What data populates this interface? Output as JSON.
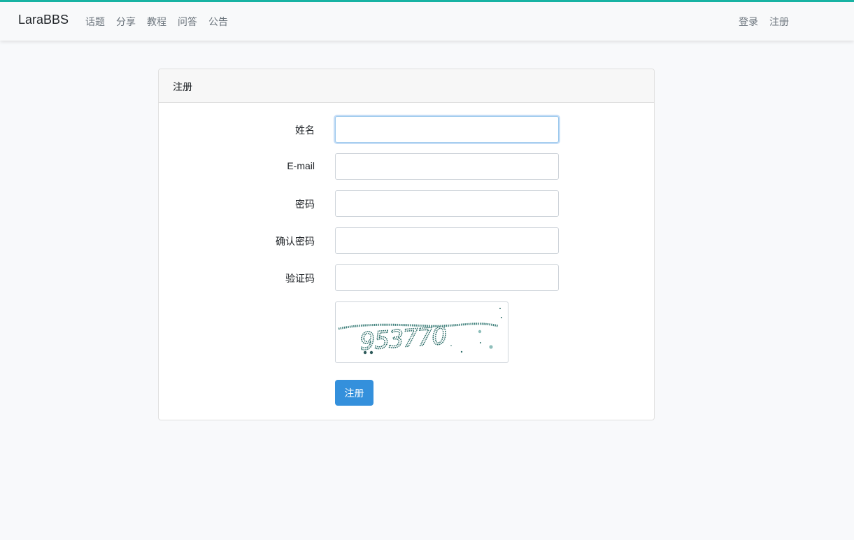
{
  "header": {
    "brand": "LaraBBS",
    "nav": [
      {
        "label": "话题"
      },
      {
        "label": "分享"
      },
      {
        "label": "教程"
      },
      {
        "label": "问答"
      },
      {
        "label": "公告"
      }
    ],
    "auth": {
      "login": "登录",
      "register": "注册"
    },
    "accent_color": "#17b3a3"
  },
  "card": {
    "title": "注册",
    "fields": [
      {
        "label": "姓名",
        "value": ""
      },
      {
        "label": "E-mail",
        "value": ""
      },
      {
        "label": "密码",
        "value": ""
      },
      {
        "label": "确认密码",
        "value": ""
      },
      {
        "label": "验证码",
        "value": ""
      }
    ],
    "captcha_text": "953770",
    "submit_label": "注册",
    "button_color": "#3490dc"
  }
}
